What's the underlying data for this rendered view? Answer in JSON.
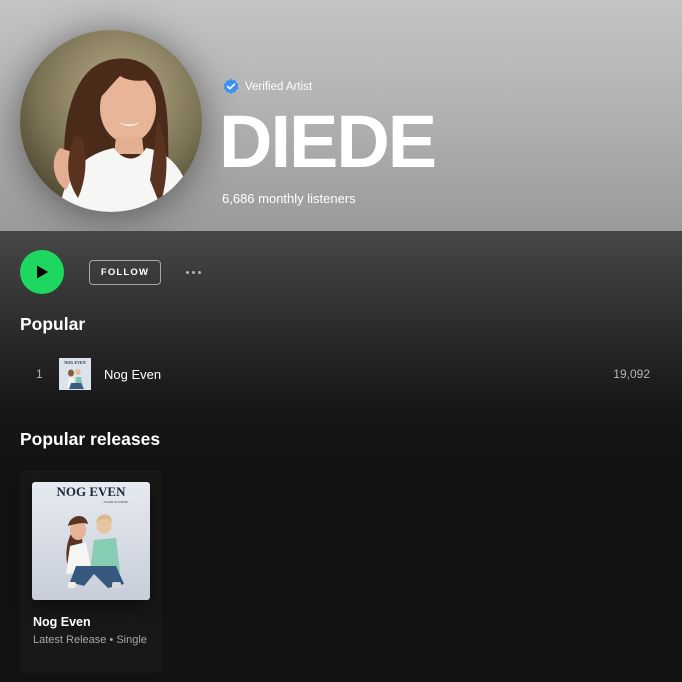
{
  "artist": {
    "verified_label": "Verified Artist",
    "name": "DIEDE",
    "monthly_listeners": "6,686 monthly listeners"
  },
  "actions": {
    "follow_label": "FOLLOW"
  },
  "popular": {
    "title": "Popular",
    "tracks": [
      {
        "rank": "1",
        "title": "Nog Even",
        "plays": "19,092",
        "thumb_text": "NOG EVEN"
      }
    ]
  },
  "releases": {
    "title": "Popular releases",
    "items": [
      {
        "cover_title": "NOG EVEN",
        "cover_subtitle": "NOOR & DIEDE",
        "title": "Nog Even",
        "subtitle": "Latest Release • Single"
      }
    ]
  },
  "colors": {
    "accent_green": "#1ed760",
    "verified_blue": "#3d91f4",
    "background": "#121212"
  },
  "icons": [
    "verified-badge-icon",
    "play-icon",
    "more-options-icon"
  ]
}
